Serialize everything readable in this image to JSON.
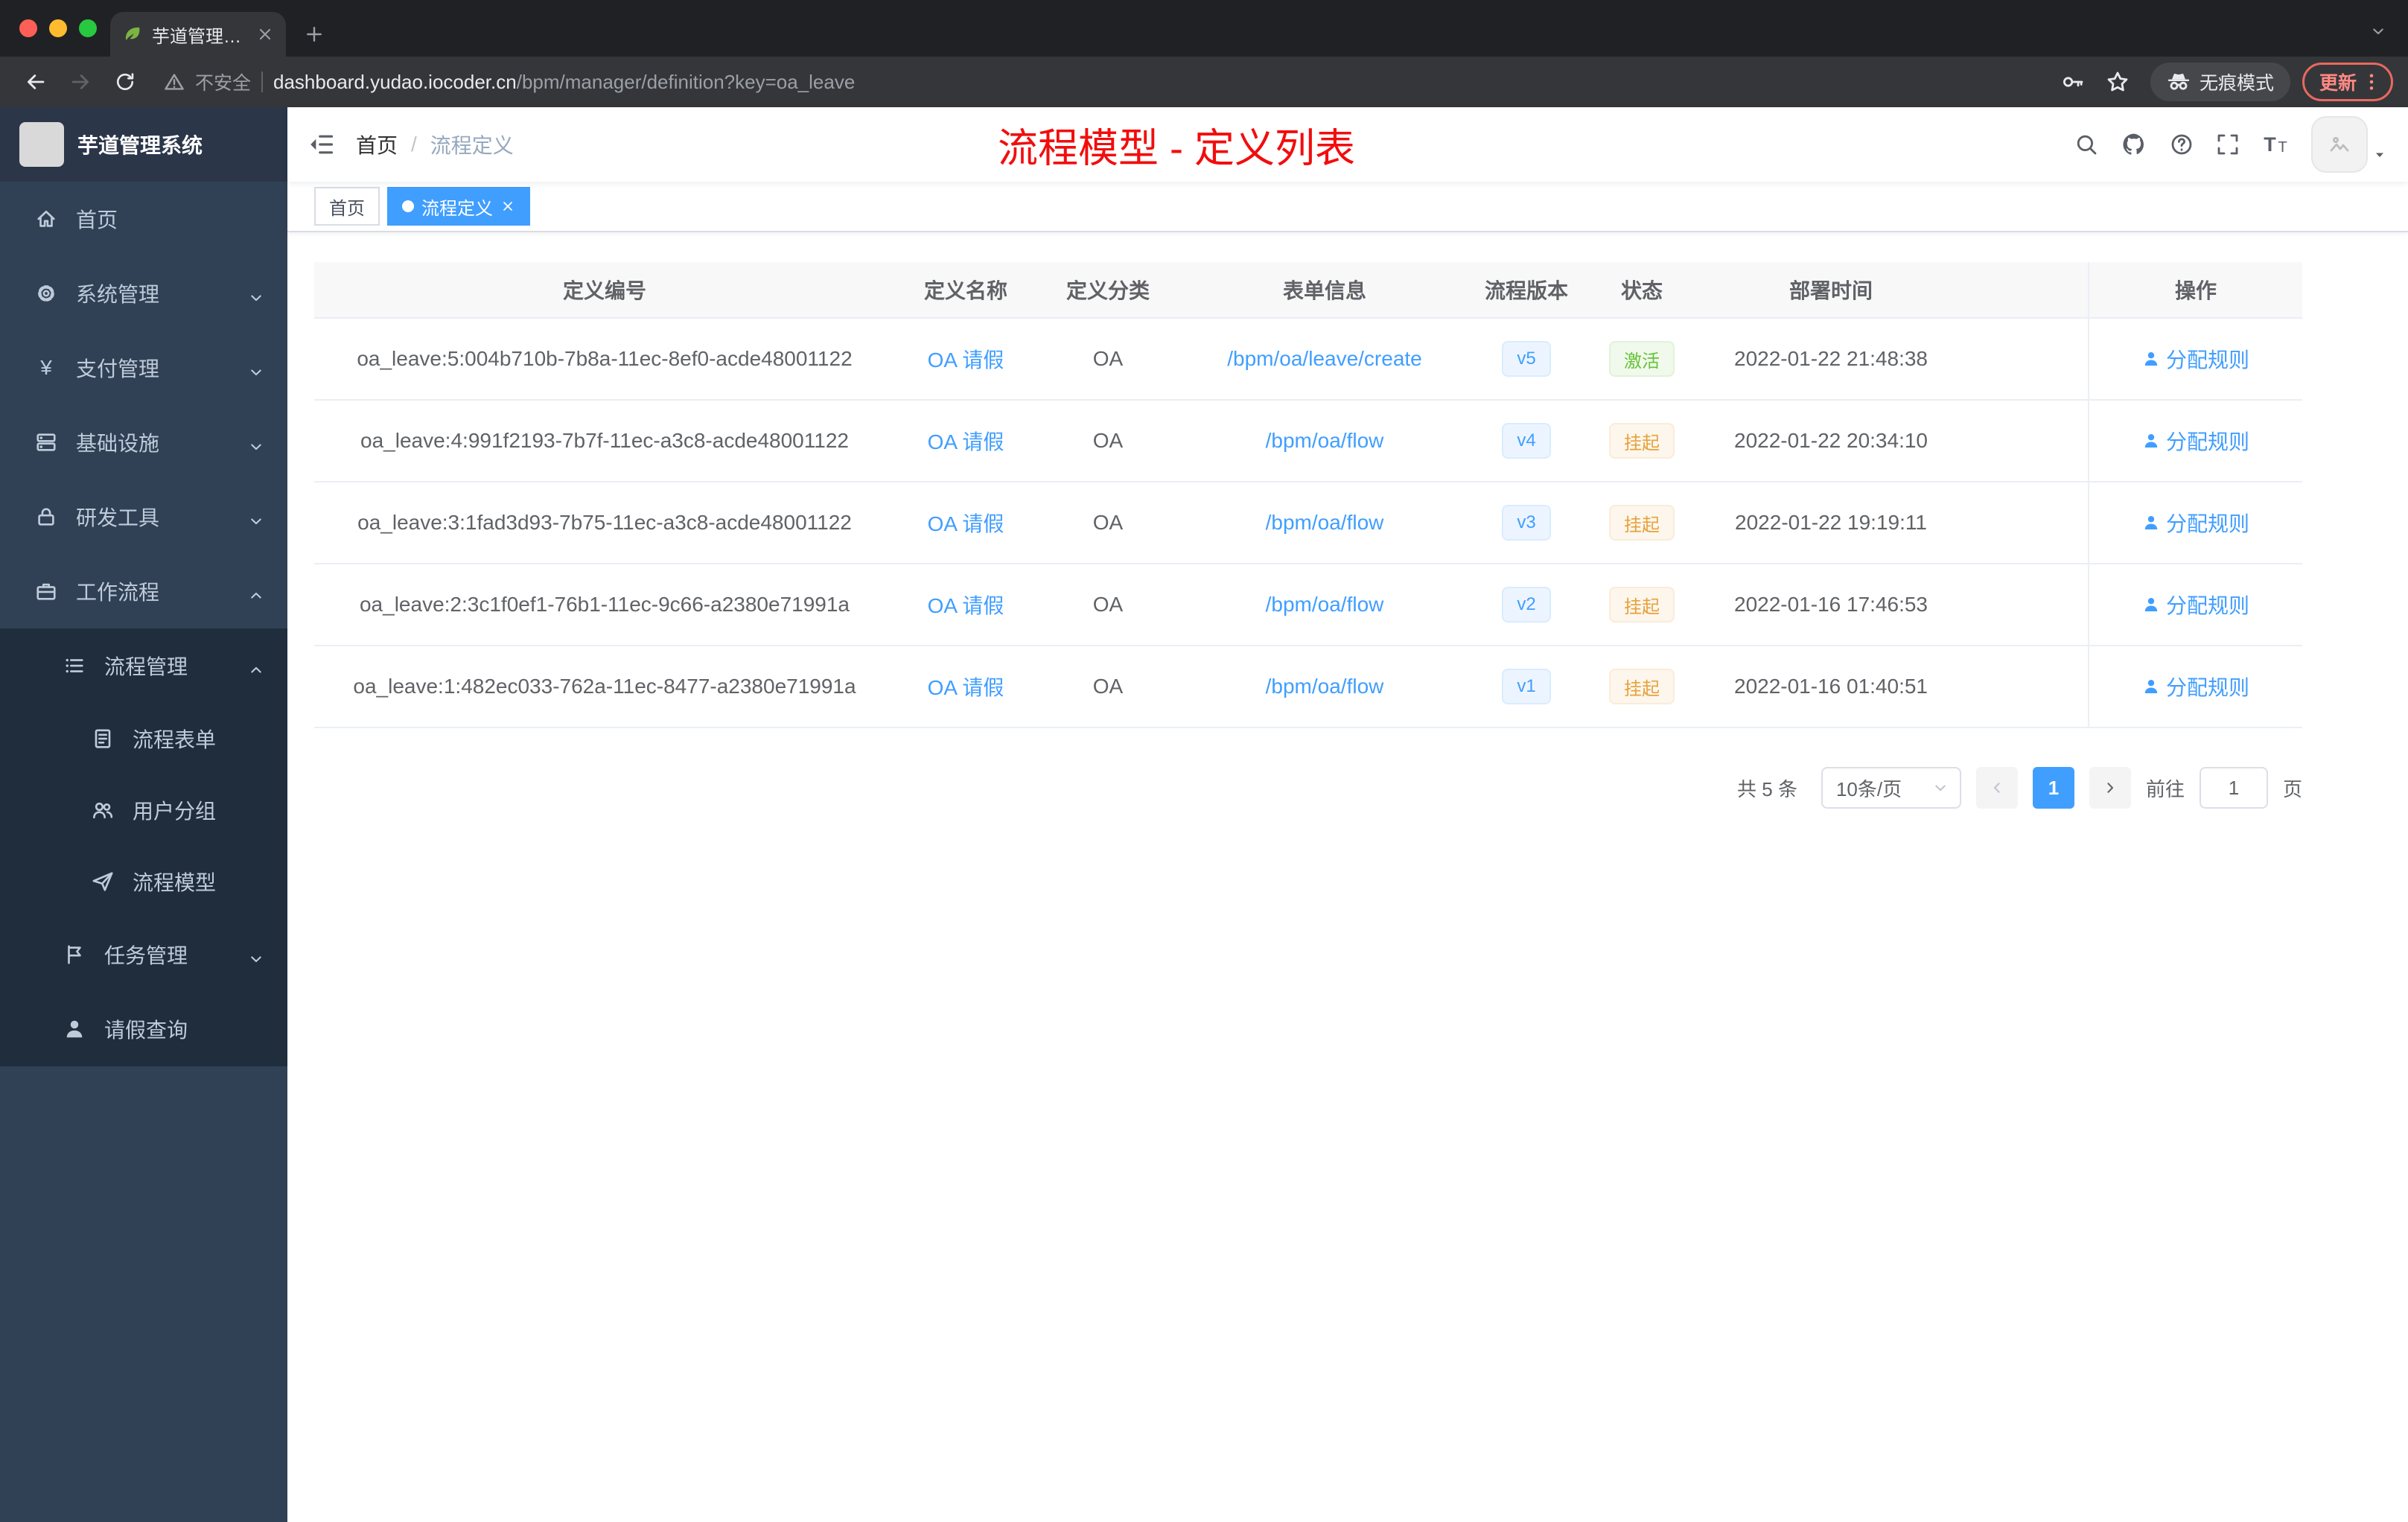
{
  "browser": {
    "tab_title": "芋道管理系统",
    "security_label": "不安全",
    "url_host": "dashboard.yudao.iocoder.cn",
    "url_path": "/bpm/manager/definition?key=oa_leave",
    "incognito_label": "无痕模式",
    "update_label": "更新"
  },
  "sidebar": {
    "logo_title": "芋道管理系统",
    "items": [
      {
        "label": "首页",
        "icon": "home-icon"
      },
      {
        "label": "系统管理",
        "icon": "gear-icon"
      },
      {
        "label": "支付管理",
        "icon": "yen-icon"
      },
      {
        "label": "基础设施",
        "icon": "infrastructure-icon"
      },
      {
        "label": "研发工具",
        "icon": "devtools-icon"
      },
      {
        "label": "工作流程",
        "icon": "workflow-icon"
      },
      {
        "label": "流程管理",
        "icon": "process-management-icon"
      },
      {
        "label": "流程表单",
        "icon": "process-form-icon"
      },
      {
        "label": "用户分组",
        "icon": "user-group-icon"
      },
      {
        "label": "流程模型",
        "icon": "process-model-icon"
      },
      {
        "label": "任务管理",
        "icon": "task-management-icon"
      },
      {
        "label": "请假查询",
        "icon": "leave-query-icon"
      }
    ]
  },
  "navbar": {
    "breadcrumb_home": "首页",
    "breadcrumb_separator": "/",
    "breadcrumb_current": "流程定义",
    "annotation": "流程模型 - 定义列表"
  },
  "tags": {
    "home": "首页",
    "active": "流程定义"
  },
  "table": {
    "columns": [
      "定义编号",
      "定义名称",
      "定义分类",
      "表单信息",
      "流程版本",
      "状态",
      "部署时间",
      "操作"
    ],
    "rows": [
      {
        "id": "oa_leave:5:004b710b-7b8a-11ec-8ef0-acde48001122",
        "name": "OA 请假",
        "category": "OA",
        "form": "/bpm/oa/leave/create",
        "version": "v5",
        "status": "激活",
        "status_type": "success",
        "deploy_time": "2022-01-22 21:48:38",
        "action": "分配规则"
      },
      {
        "id": "oa_leave:4:991f2193-7b7f-11ec-a3c8-acde48001122",
        "name": "OA 请假",
        "category": "OA",
        "form": "/bpm/oa/flow",
        "version": "v4",
        "status": "挂起",
        "status_type": "warning",
        "deploy_time": "2022-01-22 20:34:10",
        "action": "分配规则"
      },
      {
        "id": "oa_leave:3:1fad3d93-7b75-11ec-a3c8-acde48001122",
        "name": "OA 请假",
        "category": "OA",
        "form": "/bpm/oa/flow",
        "version": "v3",
        "status": "挂起",
        "status_type": "warning",
        "deploy_time": "2022-01-22 19:19:11",
        "action": "分配规则"
      },
      {
        "id": "oa_leave:2:3c1f0ef1-76b1-11ec-9c66-a2380e71991a",
        "name": "OA 请假",
        "category": "OA",
        "form": "/bpm/oa/flow",
        "version": "v2",
        "status": "挂起",
        "status_type": "warning",
        "deploy_time": "2022-01-16 17:46:53",
        "action": "分配规则"
      },
      {
        "id": "oa_leave:1:482ec033-762a-11ec-8477-a2380e71991a",
        "name": "OA 请假",
        "category": "OA",
        "form": "/bpm/oa/flow",
        "version": "v1",
        "status": "挂起",
        "status_type": "warning",
        "deploy_time": "2022-01-16 01:40:51",
        "action": "分配规则"
      }
    ]
  },
  "pagination": {
    "total": "共 5 条",
    "page_size": "10条/页",
    "current_page": "1",
    "goto_label": "前往",
    "goto_value": "1",
    "unit_label": "页"
  }
}
